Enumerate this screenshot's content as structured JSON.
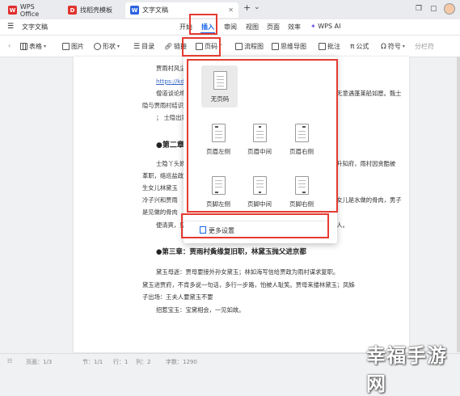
{
  "titlebar": {
    "tabs": [
      {
        "label": "WPS Office",
        "logo": "W",
        "color": "#e02b2b"
      },
      {
        "label": "找稻壳模板",
        "logo": "D",
        "color": "#e0322b"
      },
      {
        "label": "文字文稿",
        "logo": "W",
        "color": "#2b62e0"
      }
    ],
    "add": "+",
    "add_caret": "⌄"
  },
  "menubar": {
    "file_label": "文字文稿",
    "items": [
      "开始",
      "插入",
      "审阅",
      "视图",
      "页面",
      "效率",
      "WPS AI"
    ],
    "active": "插入"
  },
  "toolbar": {
    "items": [
      "表格",
      "图片",
      "形状",
      "目录",
      "链接",
      "页码",
      "流程图",
      "思维导图",
      "批注",
      "公式",
      "符号",
      "分栏符"
    ]
  },
  "document": {
    "lines": [
      {
        "text": "贾雨村风尘怀",
        "type": "normal"
      },
      {
        "text": "https://kdocs",
        "type": "link"
      },
      {
        "text": "僧道谈论绛珠",
        "type": "normal"
      },
      {
        "text": "隐与贾雨村结识",
        "type": "normal"
      },
      {
        "text": "；  士隐出家",
        "type": "normal"
      },
      {
        "text": "●第二章",
        "type": "head"
      },
      {
        "text": "士隐丫头娇杏",
        "type": "normal"
      },
      {
        "text": "革职，络巡盐政",
        "type": "normal"
      },
      {
        "text": "生女儿林黛玉",
        "type": "normal"
      },
      {
        "text": "冷子兴和贾雨",
        "type": "normal"
      },
      {
        "text": "是见做的骨肉",
        "type": "normal"
      },
      {
        "text": "便清爽，见了",
        "type": "normal"
      },
      {
        "text": "●第三章：贾雨村夤缘复旧职，林黛玉抛父进京都",
        "type": "head"
      },
      {
        "text": "黛玉母逝：贾母要接外孙女黛玉；林如海写信给贾政为雨村谋求复职。",
        "type": "normal"
      },
      {
        "text": "黛玉进贾府，不肯多说一句话，多行一步路，怕被人耻笑。贾母来搂林黛玉；凤姊",
        "type": "normal"
      },
      {
        "text": "子出场：王夫人要黛玉不要",
        "type": "normal"
      },
      {
        "text": "招惹宝玉：宝黛相会，一见如故。",
        "type": "normal"
      }
    ],
    "right_fragments": [
      {
        "text": "，无意遇蓬莱船如愿。甄士",
        "type": "normal"
      },
      {
        "text": "后升知府，雨村因贪酷被",
        "type": "normal"
      },
      {
        "text": "，女儿是水做的骨肉，男子",
        "type": "normal"
      },
      {
        "text": "之人。",
        "type": "normal"
      }
    ]
  },
  "dropdown": {
    "none_label": "无页码",
    "header_labels": [
      "页眉左侧",
      "页眉中间",
      "页眉右侧"
    ],
    "footer_labels": [
      "页脚左侧",
      "页脚中间",
      "页脚右侧"
    ],
    "more_label": "更多设置"
  },
  "statusbar": {
    "items": [
      "页面：1/3",
      "节：1/1",
      "行：1",
      "列：2",
      "字数：1290"
    ]
  },
  "watermark": "幸福手游网",
  "colors": {
    "accent": "#1a66e8",
    "highlight": "#e43b32"
  }
}
